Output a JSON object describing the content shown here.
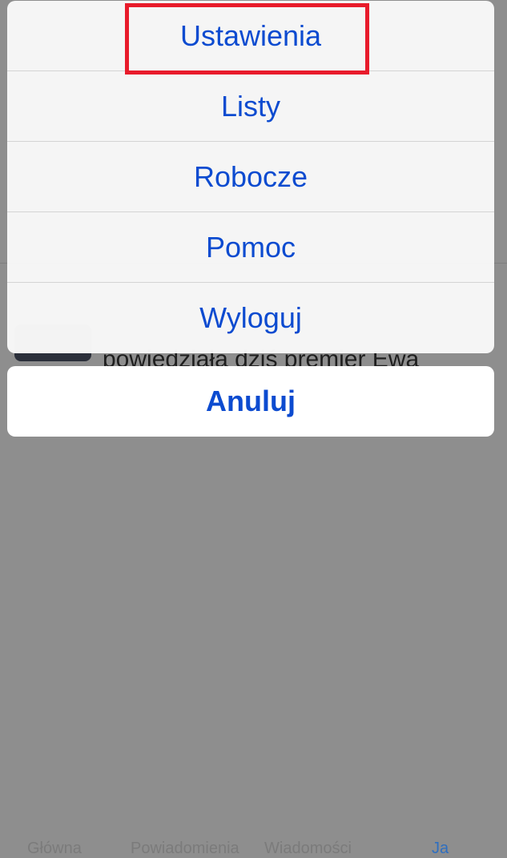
{
  "background": {
    "tweet_text": "powiedziała dziś premier Ewa",
    "tabs": [
      "Główna",
      "Powiadomienia",
      "Wiadomości",
      "Ja"
    ]
  },
  "action_sheet": {
    "items": [
      "Ustawienia",
      "Listy",
      "Robocze",
      "Pomoc",
      "Wyloguj"
    ],
    "cancel_label": "Anuluj"
  },
  "colors": {
    "accent": "#0c4bd0",
    "highlight": "#e81b2b"
  }
}
